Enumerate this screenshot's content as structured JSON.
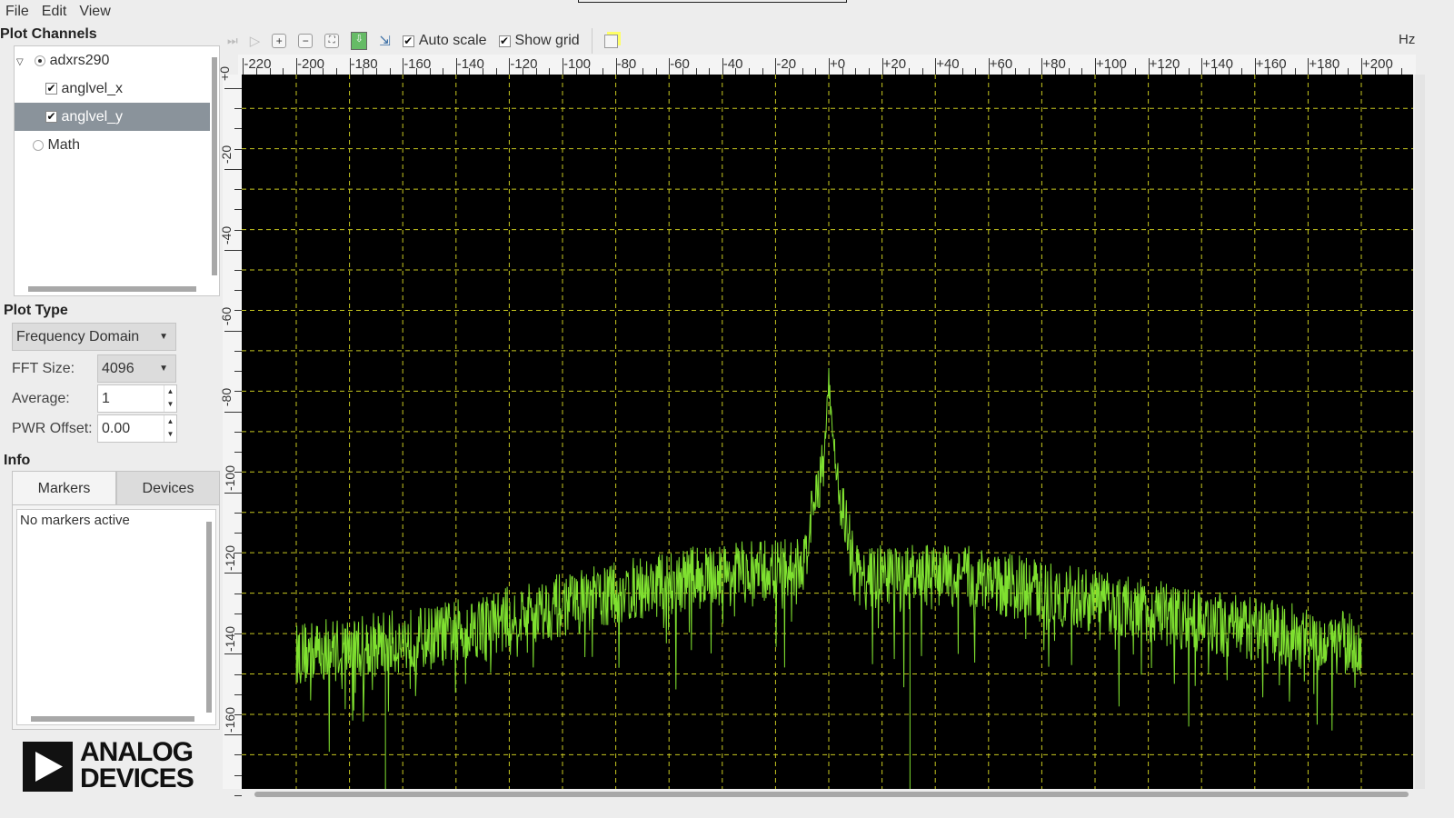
{
  "menu": {
    "file": "File",
    "edit": "Edit",
    "view": "View"
  },
  "channels": {
    "title": "Plot Channels",
    "device": "adxrs290",
    "items": [
      {
        "label": "anglvel_x",
        "checked": true
      },
      {
        "label": "anglvel_y",
        "checked": true,
        "selected": true
      }
    ],
    "math": "Math"
  },
  "plot_type": {
    "title": "Plot Type",
    "value": "Frequency Domain",
    "fft_label": "FFT Size:",
    "fft_value": "4096",
    "avg_label": "Average:",
    "avg_value": "1",
    "pwr_label": "PWR Offset:",
    "pwr_value": "0.00"
  },
  "info": {
    "title": "Info",
    "tabs": [
      "Markers",
      "Devices"
    ],
    "active_tab": "Markers",
    "text": "No markers active"
  },
  "logo": {
    "line1": "ANALOG",
    "line2": "DEVICES"
  },
  "toolbar": {
    "auto_scale": "Auto scale",
    "auto_scale_checked": true,
    "show_grid": "Show grid",
    "show_grid_checked": true,
    "unit": "Hz",
    "icons": [
      "skip-icon",
      "play-icon",
      "zoom-in-icon",
      "zoom-out-icon",
      "fit-icon",
      "capture-icon",
      "export-icon",
      "new-window-icon"
    ]
  },
  "chart_data": {
    "type": "line",
    "xlabel": "Hz",
    "xlim": [
      -220,
      220
    ],
    "ylim": [
      -168,
      3
    ],
    "x_ticks": [
      "-220",
      "-200",
      "-180",
      "-160",
      "-140",
      "-120",
      "-100",
      "-80",
      "-60",
      "-40",
      "-20",
      "+0",
      "+20",
      "+40",
      "+60",
      "+80",
      "+100",
      "+120",
      "+140",
      "+160",
      "+180",
      "+200"
    ],
    "y_ticks": [
      "+0",
      "-20",
      "-40",
      "-60",
      "-80",
      "-100",
      "-120",
      "-140",
      "-160"
    ],
    "grid": true,
    "background": "#000000",
    "grid_color": "#c8c820",
    "line_color": "#7fe030",
    "series": [
      {
        "x_range": [
          -200,
          200
        ],
        "envelope": [
          [
            -200,
            -140
          ],
          [
            -150,
            -136
          ],
          [
            -100,
            -128
          ],
          [
            -50,
            -121
          ],
          [
            -10,
            -119
          ],
          [
            -2,
            -92
          ],
          [
            0,
            -72
          ],
          [
            2,
            -92
          ],
          [
            10,
            -121
          ],
          [
            50,
            -121
          ],
          [
            100,
            -127
          ],
          [
            150,
            -133
          ],
          [
            200,
            -138
          ]
        ],
        "peak": {
          "x": 0,
          "y": -72
        }
      }
    ]
  }
}
